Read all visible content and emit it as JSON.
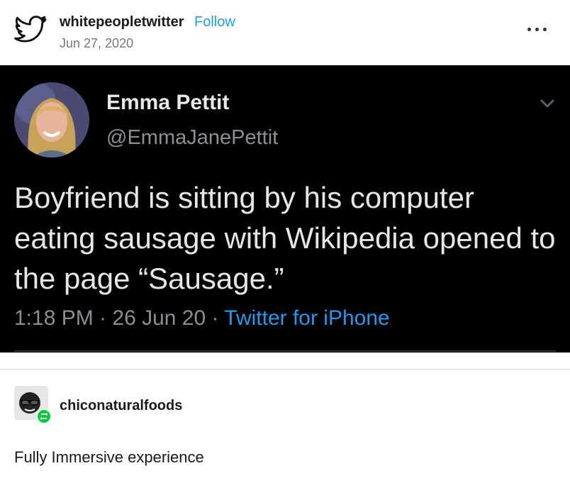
{
  "post": {
    "username": "whitepeopletwitter",
    "follow_label": "Follow",
    "date": "Jun 27, 2020",
    "avatar_icon": "twitter-bird-icon",
    "more_icon": "more-dots-icon"
  },
  "tweet": {
    "name": "Emma Pettit",
    "handle": "@EmmaJanePettit",
    "text": "Boyfriend is sitting by his computer eating sausage with Wikipedia opened to the page “Sausage.”",
    "time_date": "1:18 PM · 26 Jun 20 · ",
    "source": "Twitter for iPhone",
    "colors": {
      "background": "#000000",
      "link": "#1d9bf0"
    }
  },
  "reblog": {
    "username": "chiconaturalfoods",
    "badge_icon": "reblog-icon",
    "comment": "Fully Immersive experience"
  },
  "colors": {
    "follow": "#1da1f2",
    "reblog_badge": "#00cf35"
  }
}
